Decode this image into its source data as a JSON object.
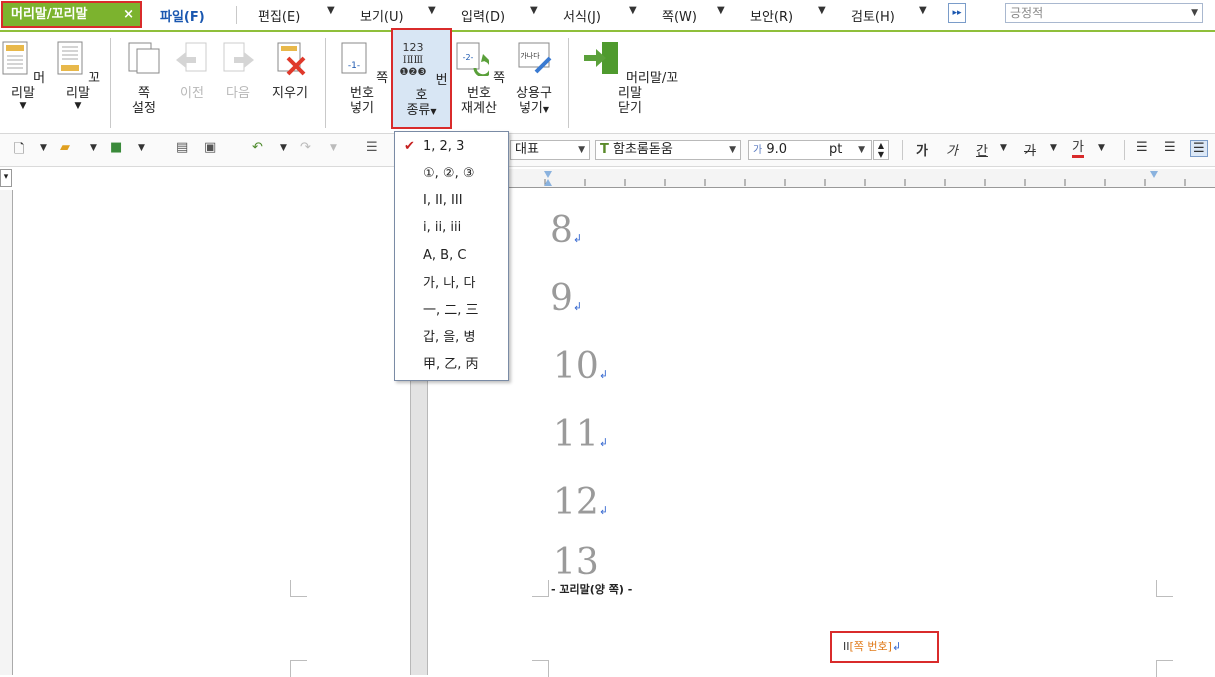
{
  "menubar": {
    "context_tab": "머리말/꼬리말",
    "context_close": "×",
    "items": [
      "파일(F)",
      "편집(E)",
      "보기(U)",
      "입력(D)",
      "서식(J)",
      "쪽(W)",
      "보안(R)",
      "검토(H)"
    ],
    "more": "▸▸",
    "style_box_value": "긍정적"
  },
  "ribbon": {
    "header_label": "머리말",
    "footer_label": "꼬리말",
    "page_setup_line1": "쪽",
    "page_setup_line2": "설정",
    "prev_label": "이전",
    "next_label": "다음",
    "delete_label": "지우기",
    "insert_page_num_line1": "쪽 번호",
    "insert_page_num_line2": "넣기",
    "num_type_line1": "번호",
    "num_type_line2": "종류",
    "renumber_line1": "쪽 번호",
    "renumber_line2": "재계산",
    "phrase_line1": "상용구",
    "phrase_line2": "넣기",
    "close_line1": "머리말/꼬리말",
    "close_line2": "닫기",
    "num_type_icon_top": "123",
    "num_type_icon_mid": "ⅠⅡⅢ",
    "num_type_icon_bottom": "❶❷❸",
    "insert_page_num_icon_text": "-1-",
    "renumber_icon_text": "-2-",
    "phrase_icon_text": "가나다"
  },
  "toolbar": {
    "style_value": "대표",
    "font_value": "함초롬돋움",
    "size_value": "9.0",
    "size_unit": "pt",
    "bold_label": "가",
    "italic_label": "가",
    "underline_label": "간",
    "strike_label": "가",
    "color_label": "가"
  },
  "number_type_menu": {
    "items": [
      "1, 2, 3",
      "①, ②, ③",
      "I, II, III",
      "i, ii, iii",
      "A, B, C",
      "가, 나, 다",
      "一, 二, 三",
      "갑, 을, 병",
      "甲, 乙, 丙"
    ],
    "selected_index": 0
  },
  "document": {
    "lines": [
      "8",
      "9",
      "10",
      "11",
      "12",
      "13"
    ],
    "para_mark": "↲",
    "footer_label": "- 꼬리말(양 쪽) -",
    "page_num_prefix": "II",
    "page_num_field": "[쪽 번호]"
  },
  "colors": {
    "context_tab_bg": "#7cb32e",
    "highlight_border": "#d92b2b",
    "checkmark": "#c62020",
    "field_text": "#e07a1a"
  }
}
